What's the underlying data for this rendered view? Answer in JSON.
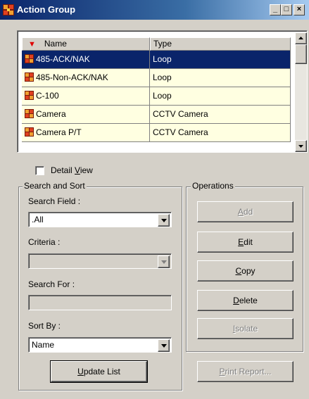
{
  "window": {
    "title": "Action Group",
    "minimize_glyph": "_",
    "maximize_glyph": "□",
    "close_glyph": "×"
  },
  "grid": {
    "columns": [
      {
        "label": "Name",
        "sort_indicator": "▼"
      },
      {
        "label": "Type"
      }
    ],
    "rows": [
      {
        "name": "485-ACK/NAK",
        "type": "Loop",
        "selected": true
      },
      {
        "name": "485-Non-ACK/NAK",
        "type": "Loop"
      },
      {
        "name": "C-100",
        "type": "Loop"
      },
      {
        "name": "Camera",
        "type": "CCTV Camera"
      },
      {
        "name": "Camera P/T",
        "type": "CCTV Camera"
      }
    ]
  },
  "detail_view": {
    "label_pre": "Detail ",
    "label_ul": "V",
    "label_post": "iew",
    "checked": false
  },
  "search": {
    "group_title": "Search and Sort",
    "field_label": "Search Field :",
    "field_value": ".All",
    "criteria_label": "Criteria :",
    "criteria_value": "",
    "for_label": "Search For :",
    "for_value": "",
    "sort_label": "Sort By :",
    "sort_value": "Name",
    "update_pre": "",
    "update_ul": "U",
    "update_post": "pdate List"
  },
  "operations": {
    "group_title": "Operations",
    "add": {
      "ul": "A",
      "post": "dd"
    },
    "edit": {
      "ul": "E",
      "post": "dit"
    },
    "copy": {
      "ul": "C",
      "post": "opy"
    },
    "delete": {
      "ul": "D",
      "post": "elete"
    },
    "isolate": {
      "ul": "I",
      "post": "solate"
    },
    "print": {
      "ul": "P",
      "post": "rint Report..."
    }
  },
  "colors": {
    "selection": "#0a246a",
    "row_bg": "#ffffe1",
    "sort_arrow": "#e00000",
    "icon": "#c0392b"
  }
}
